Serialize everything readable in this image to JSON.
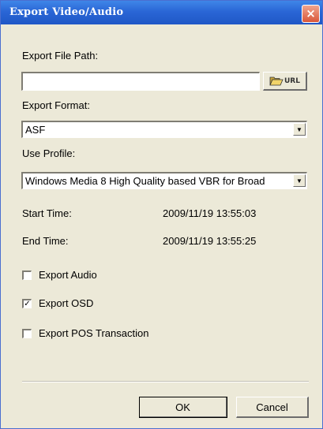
{
  "window": {
    "title": "Export Video/Audio",
    "close_label": "×"
  },
  "export_path": {
    "label": "Export File Path:",
    "value": "",
    "browse_label": "URL",
    "browse_icon": "open-folder-icon"
  },
  "export_format": {
    "label": "Export Format:",
    "selected": "ASF"
  },
  "profile": {
    "label": "Use Profile:",
    "selected": "Windows Media 8 High Quality based VBR for Broad"
  },
  "times": {
    "start_label": "Start Time:",
    "start_value": "2009/11/19 13:55:03",
    "end_label": "End Time:",
    "end_value": "2009/11/19 13:55:25"
  },
  "options": [
    {
      "label": "Export Audio",
      "checked": false
    },
    {
      "label": "Export OSD",
      "checked": true
    },
    {
      "label": "Export POS Transaction",
      "checked": false
    }
  ],
  "buttons": {
    "ok": "OK",
    "cancel": "Cancel"
  },
  "colors": {
    "title_bar": "#2a66d6",
    "close_button": "#d9573a",
    "dialog_background": "#ece9d8"
  }
}
